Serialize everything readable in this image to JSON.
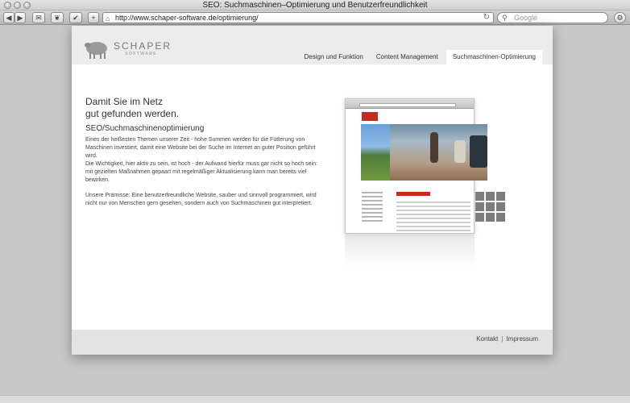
{
  "window": {
    "title": "SEO: Suchmaschinen–Optimierung und Benutzerfreundlichkeit"
  },
  "toolbar": {
    "back": "◀",
    "forward": "▶",
    "mail": "✉",
    "leaf": "❦",
    "check": "✔",
    "add": "+",
    "url": "http://www.schaper-software.de/optimierung/",
    "search_placeholder": "Google"
  },
  "site": {
    "logo_name": "SCHAPER",
    "logo_sub": "SOFTWARE",
    "nav": [
      {
        "label": "Design und Funktion",
        "active": false
      },
      {
        "label": "Content Management",
        "active": false
      },
      {
        "label": "Suchmaschinen-Optimierung",
        "active": true
      }
    ],
    "heading_line1": "Damit Sie im Netz",
    "heading_line2": "gut gefunden werden.",
    "subheading": "SEO/Suchmaschinenoptimierung",
    "paragraphs": [
      "Eines der heißesten Themen unserer Zeit - hohe Summen werden für die Fütterung von Maschinen investiert, damit eine Website bei der Suche im Internet an guter Position geführt wird.",
      "Die Wichtigkeit, hier aktiv zu sein, ist hoch - der Aufwand hierfür muss gar nicht so hoch sein: mit gezielten Maßnahmen gepaart mit regelmäßiger Aktualisierung kann man bereits viel bewirken.",
      "Unsere Prämisse: Eine benutzerfreundliche Website, sauber und sinnvoll programmiert, wird nicht nur von Menschen gern gesehen, sondern auch von Suchmaschinen gut interpretiert."
    ],
    "footer": {
      "contact": "Kontakt",
      "separator": "|",
      "imprint": "Impressum"
    }
  }
}
